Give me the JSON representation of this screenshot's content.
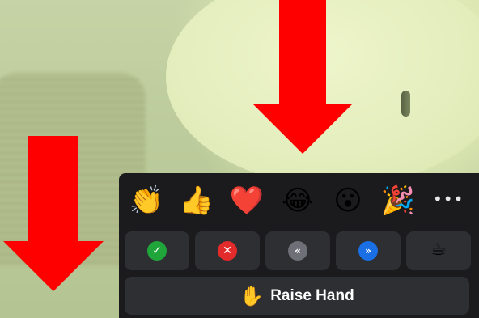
{
  "reactions": {
    "emojis": [
      {
        "icon": "clapping-hands-icon",
        "glyph": "👏"
      },
      {
        "icon": "thumbs-up-icon",
        "glyph": "👍"
      },
      {
        "icon": "red-heart-icon",
        "glyph": "❤️"
      },
      {
        "icon": "tears-of-joy-icon",
        "glyph": "😂"
      },
      {
        "icon": "surprised-face-icon",
        "glyph": "😮"
      },
      {
        "icon": "party-popper-icon",
        "glyph": "🎉"
      }
    ],
    "more_icon": "more-dots-icon",
    "more_glyph": "•••"
  },
  "feedback": {
    "buttons": [
      {
        "icon": "checkmark-icon",
        "glyph": "✓",
        "color": "#20a53b"
      },
      {
        "icon": "x-icon",
        "glyph": "✕",
        "color": "#e32b2b"
      },
      {
        "icon": "slow-down-icon",
        "glyph": "«",
        "color": "#6e7077"
      },
      {
        "icon": "speed-up-icon",
        "glyph": "»",
        "color": "#1a6fe5"
      },
      {
        "icon": "coffee-cup-icon",
        "glyph": "☕"
      }
    ]
  },
  "raise_hand": {
    "label": "Raise Hand",
    "icon": "raised-hand-icon",
    "glyph": "✋"
  },
  "colors": {
    "panel": "#1b1b1d",
    "button": "#2e2f33",
    "arrow": "#fe0000"
  }
}
